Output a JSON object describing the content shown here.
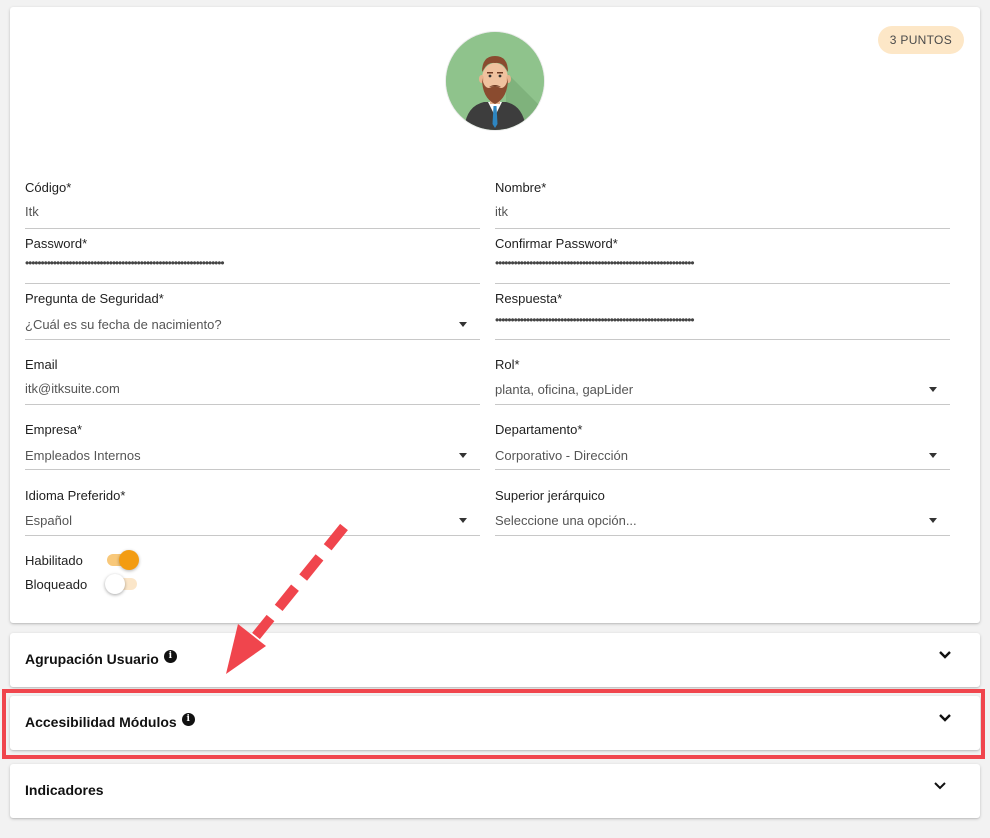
{
  "badge": "3 PUNTOS",
  "avatar": {
    "icon": "user-avatar-icon",
    "bg": "#8fc38c"
  },
  "form": {
    "codigo": {
      "label": "Código*",
      "value": "Itk"
    },
    "nombre": {
      "label": "Nombre*",
      "value": "itk"
    },
    "password": {
      "label": "Password*",
      "value": "••••••••••••••••••••••••••••••••••••••••••••••••••••••••••••••••"
    },
    "confirmar": {
      "label": "Confirmar Password*",
      "value": "••••••••••••••••••••••••••••••••••••••••••••••••••••••••••••••••"
    },
    "pregunta": {
      "label": "Pregunta de Seguridad*",
      "value": "¿Cuál es su fecha de nacimiento?"
    },
    "respuesta": {
      "label": "Respuesta*",
      "value": "••••••••••••••••••••••••••••••••••••••••••••••••••••••••••••••••"
    },
    "email": {
      "label": "Email",
      "value": "itk@itksuite.com"
    },
    "rol": {
      "label": "Rol*",
      "value": "planta, oficina, gapLider"
    },
    "empresa": {
      "label": "Empresa*",
      "value": "Empleados Internos"
    },
    "departamento": {
      "label": "Departamento*",
      "value": "Corporativo - Dirección"
    },
    "idioma": {
      "label": "Idioma Preferido*",
      "value": "Español"
    },
    "superior": {
      "label": "Superior jerárquico",
      "value": "Seleccione una opción..."
    }
  },
  "toggles": {
    "habilitado": {
      "label": "Habilitado",
      "on": true
    },
    "bloqueado": {
      "label": "Bloqueado",
      "on": false
    }
  },
  "panels": [
    {
      "title": "Agrupación Usuario",
      "info": true
    },
    {
      "title": "Accesibilidad Módulos",
      "info": true
    },
    {
      "title": "Indicadores",
      "info": false
    }
  ],
  "colors": {
    "accent": "#f39c12",
    "highlight": "#f0454d",
    "badge_bg": "#fde7c7"
  }
}
